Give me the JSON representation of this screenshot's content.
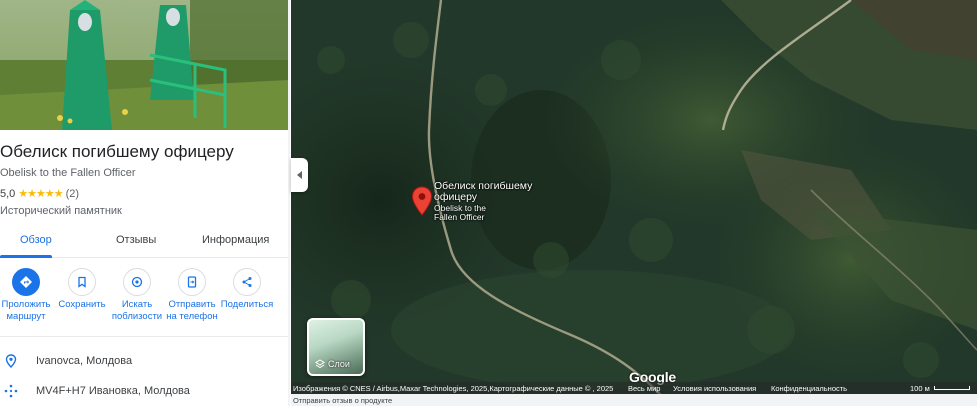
{
  "place": {
    "title": "Обелиск погибшему офицеру",
    "subtitle": "Obelisk to the Fallen Officer",
    "rating_value": "5,0",
    "stars": "★★★★★",
    "rating_count": "(2)",
    "category": "Исторический памятник"
  },
  "tabs": [
    {
      "label": "Обзор",
      "active": true
    },
    {
      "label": "Отзывы",
      "active": false
    },
    {
      "label": "Информация",
      "active": false
    }
  ],
  "actions": [
    {
      "label": "Проложить маршрут",
      "icon": "directions-icon"
    },
    {
      "label": "Сохранить",
      "icon": "bookmark-icon"
    },
    {
      "label": "Искать поблизости",
      "icon": "nearby-icon"
    },
    {
      "label": "Отправить на телефон",
      "icon": "send-to-phone-icon"
    },
    {
      "label": "Поделиться",
      "icon": "share-icon"
    }
  ],
  "info": {
    "address": "Ivanovca, Молдова",
    "plus_code": "MV4F+H7 Ивановка, Молдова"
  },
  "map": {
    "marker_title": "Обелиск погибшему офицеру",
    "marker_subtitle": "Obelisk to the Fallen Officer",
    "layers_label": "Слои",
    "google_logo": "Google",
    "attribution": "Изображения © CNES / Airbus,Maxar Technologies, 2025,Картографические данные © , 2025",
    "country": "Весь мир",
    "terms": "Условия использования",
    "privacy": "Конфиденциальность",
    "scale": "100 м",
    "feedback": "Отправить отзыв о продукте"
  },
  "colors": {
    "accent": "#1a73e8",
    "marker": "#ea4335",
    "stars": "#fbbc04"
  }
}
